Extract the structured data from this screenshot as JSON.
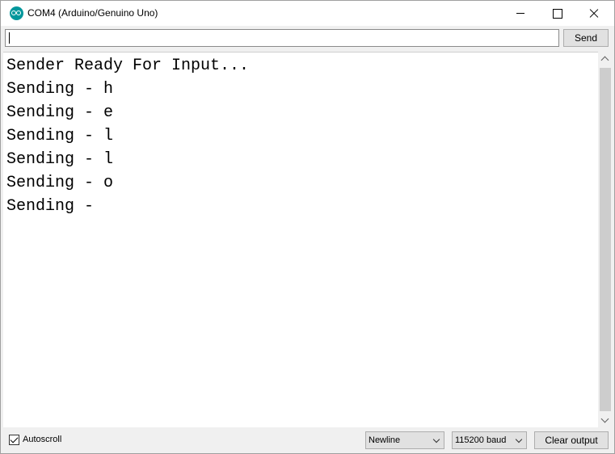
{
  "window": {
    "title": "COM4 (Arduino/Genuino Uno)"
  },
  "input": {
    "value": "",
    "send_label": "Send"
  },
  "output": {
    "lines": [
      "Sender Ready For Input...",
      "Sending - h",
      "Sending - e",
      "Sending - l",
      "Sending - l",
      "Sending - o",
      "Sending -"
    ]
  },
  "bottom": {
    "autoscroll_label": "Autoscroll",
    "autoscroll_checked": true,
    "line_ending": "Newline",
    "baud_rate": "115200 baud",
    "clear_label": "Clear output"
  },
  "colors": {
    "arduino_teal": "#00979c"
  }
}
